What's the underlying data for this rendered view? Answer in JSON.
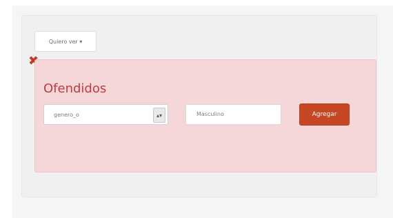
{
  "dropdown": {
    "label": "Quiero ver ▾"
  },
  "panel": {
    "title": "Ofendidos",
    "select_value": "genero_o",
    "input_value": "Masculino",
    "submit_label": "Agregar"
  },
  "icons": {
    "close": "close-icon",
    "select_arrow": "chevron-updown-icon"
  },
  "colors": {
    "accent": "#c54724",
    "panel": "#f6d7d9",
    "title": "#c23b37",
    "close": "#c0392b"
  }
}
